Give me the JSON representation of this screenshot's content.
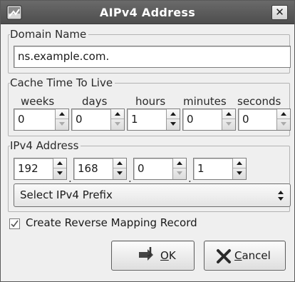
{
  "window": {
    "title": "AIPv4 Address",
    "close_glyph": "✕",
    "icon": "app-dialog-icon"
  },
  "domain": {
    "legend": "Domain Name",
    "value": "ns.example.com."
  },
  "ttl": {
    "legend": "Cache Time To Live",
    "fields": [
      {
        "label": "weeks",
        "value": "0"
      },
      {
        "label": "days",
        "value": "0"
      },
      {
        "label": "hours",
        "value": "1"
      },
      {
        "label": "minutes",
        "value": "0"
      },
      {
        "label": "seconds",
        "value": "0"
      }
    ]
  },
  "ipv4": {
    "legend": "IPv4 Address",
    "octets": [
      "192",
      "168",
      "0",
      "1"
    ],
    "separator": ".",
    "prefix_select": "Select IPv4 Prefix"
  },
  "reverse": {
    "label": "Create Reverse Mapping Record",
    "checked": true,
    "check_glyph": "✓"
  },
  "buttons": {
    "ok_mnemonic": "O",
    "ok_rest": "K",
    "cancel_mnemonic": "C",
    "cancel_rest": "ancel"
  },
  "colors": {
    "titlebar": "#5a5a5a",
    "dialog_bg": "#efefef"
  }
}
